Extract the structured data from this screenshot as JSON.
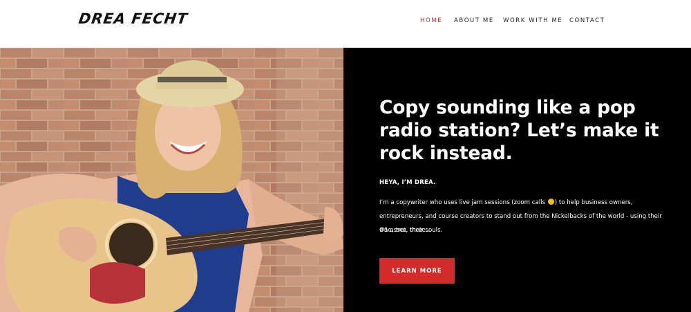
{
  "header": {
    "logo_text": "DREA FECHT",
    "nav": [
      {
        "label": "HOME",
        "active": true
      },
      {
        "label": "ABOUT ME",
        "active": false
      },
      {
        "label": "WORK WITH ME",
        "active": false
      },
      {
        "label": "CONTACT",
        "active": false
      }
    ]
  },
  "hero": {
    "headline": "Copy sounding like a pop radio station? Let’s make it rock instead.",
    "kicker": "HEYA, I’M DREA.",
    "body_before_emoji": "I’m a copywriter who uses live jam sessions (zoom calls ",
    "emoji_icon": "grinning-face-emoji",
    "body_after_emoji": ") to help business owners, entrepreneurs, and course creators to stand out from the Nickelbacks of the world - using their #1 asset, their souls.",
    "tagline": "One, two, three…",
    "cta_label": "LEARN MORE"
  },
  "colors": {
    "accent": "#d42a2a",
    "nav_active": "#d62828",
    "panel_bg": "#000000",
    "text_light": "#ffffff"
  }
}
